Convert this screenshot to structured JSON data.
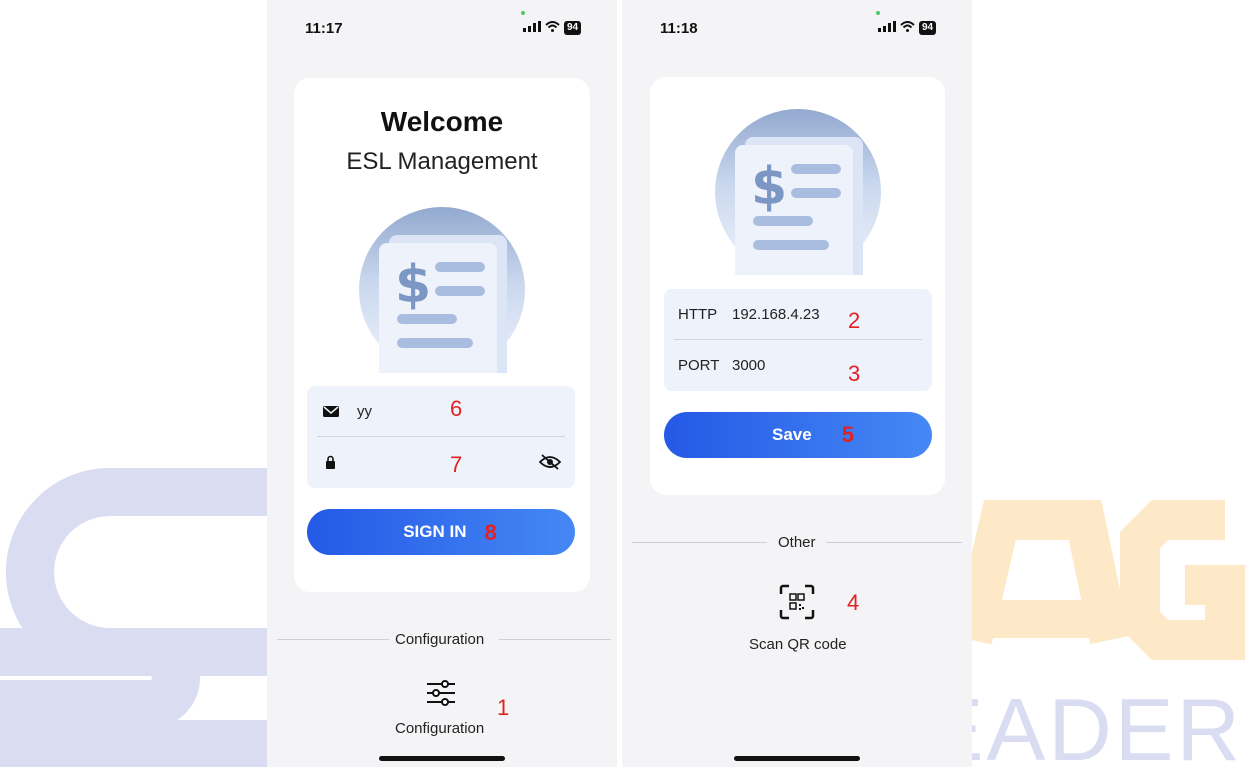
{
  "watermark": {
    "brand_text": "EADER",
    "colors": {
      "lavender": "#dadcf1",
      "orange": "#fde9c8"
    }
  },
  "left_screen": {
    "status": {
      "time": "11:17",
      "signal": "ııll",
      "battery": "94"
    },
    "title": "Welcome",
    "subtitle": "ESL Management",
    "illustration_icon": "dollar-document-icon",
    "email_field": {
      "icon": "envelope-icon",
      "value": "yy",
      "annotation": "6"
    },
    "password_field": {
      "icon": "lock-icon",
      "value": "",
      "toggle_icon": "eye-slash-icon",
      "annotation": "7"
    },
    "sign_in_button": {
      "label": "SIGN IN",
      "annotation": "8"
    },
    "section_label": "Configuration",
    "config_button": {
      "icon": "sliders-icon",
      "label": "Configuration",
      "annotation": "1"
    }
  },
  "right_screen": {
    "status": {
      "time": "11:18",
      "signal": "ııll",
      "battery": "94"
    },
    "illustration_icon": "dollar-document-icon",
    "http_field": {
      "key": "HTTP",
      "value": "192.168.4.23",
      "annotation": "2"
    },
    "port_field": {
      "key": "PORT",
      "value": "3000",
      "annotation": "3"
    },
    "save_button": {
      "label": "Save",
      "annotation": "5"
    },
    "section_label": "Other",
    "scan_button": {
      "icon": "qr-scan-icon",
      "label": "Scan QR code",
      "annotation": "4"
    }
  },
  "colors": {
    "accent_start": "#2459e6",
    "accent_end": "#4588f4",
    "annotation": "#e22222",
    "input_bg": "#eef2fb",
    "screen_bg": "#f4f4f6"
  }
}
